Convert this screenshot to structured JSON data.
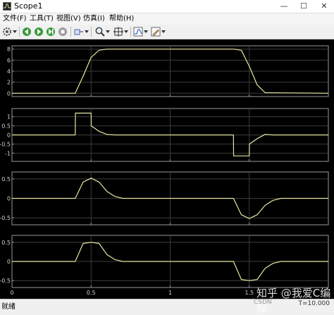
{
  "window": {
    "title": "Scope1",
    "minimize": "—",
    "maximize": "☐",
    "close": "✕"
  },
  "menu": [
    "文件(F)",
    "工具(T)",
    "视图(V)",
    "仿真(I)",
    "帮助(H)"
  ],
  "toolbar": {
    "icons": [
      "gear-icon",
      "back-icon",
      "run-icon",
      "step-forward-icon",
      "stop-icon",
      "zoom-icon",
      "autoscale-icon",
      "cursor-measure-icon",
      "edit-style-icon"
    ]
  },
  "status": {
    "left": "就绪",
    "right": "T=10.000"
  },
  "watermark": {
    "main": "知乎 @我爱C编程",
    "sub": "CSDN"
  },
  "colors": {
    "trace": "#e8e6a0",
    "grid": "#3c3c3c",
    "axes": "#9a9a9a",
    "plot_bg": "#000000"
  },
  "chart_data": [
    {
      "type": "line",
      "x": [
        0,
        0.4,
        0.45,
        0.5,
        0.55,
        0.6,
        1.4,
        1.45,
        1.5,
        1.55,
        1.6,
        2.0
      ],
      "series": [
        {
          "values": [
            0,
            0,
            3.1,
            6.5,
            7.8,
            8,
            8,
            7.8,
            4.9,
            1.5,
            0.1,
            0
          ]
        }
      ],
      "yticks": [
        "8",
        "6",
        "4",
        "2",
        "0"
      ],
      "ylim": [
        -0.6,
        8.6
      ],
      "grid": true
    },
    {
      "type": "line",
      "x": [
        0,
        0.4,
        0.401,
        0.5,
        0.501,
        0.55,
        0.6,
        0.65,
        1.4,
        1.401,
        1.5,
        1.501,
        1.55,
        1.6,
        1.65,
        2.0
      ],
      "series": [
        {
          "values": [
            0,
            0,
            1.2,
            1.2,
            0.5,
            0.2,
            0.03,
            0,
            0,
            -1.15,
            -1.15,
            -0.5,
            -0.2,
            0.03,
            0,
            0
          ]
        }
      ],
      "yticks": [
        "1",
        "0.5",
        "0",
        "-0.5",
        "-1"
      ],
      "ylim": [
        -1.45,
        1.45
      ],
      "grid": true
    },
    {
      "type": "line",
      "x": [
        0,
        0.4,
        0.45,
        0.5,
        0.55,
        0.6,
        0.65,
        0.7,
        1.4,
        1.45,
        1.5,
        1.55,
        1.6,
        1.65,
        1.7,
        2.0
      ],
      "series": [
        {
          "values": [
            0,
            0,
            0.42,
            0.52,
            0.42,
            0.18,
            0.05,
            0,
            0,
            -0.42,
            -0.52,
            -0.42,
            -0.18,
            -0.05,
            0,
            0
          ]
        }
      ],
      "yticks": [
        "0.5",
        "0",
        "-0.5"
      ],
      "ylim": [
        -0.68,
        0.68
      ],
      "grid": true
    },
    {
      "type": "line",
      "x": [
        0,
        0.4,
        0.45,
        0.5,
        0.55,
        0.6,
        0.65,
        0.7,
        1.4,
        1.45,
        1.5,
        1.55,
        1.6,
        1.65,
        1.7,
        2.0
      ],
      "series": [
        {
          "values": [
            0,
            0,
            0.47,
            0.5,
            0.47,
            0.18,
            0.05,
            0,
            0,
            -0.47,
            -0.5,
            -0.47,
            -0.18,
            -0.05,
            0,
            0
          ]
        }
      ],
      "yticks": [
        "0.5",
        "0",
        "-0.5"
      ],
      "ylim": [
        -0.68,
        0.68
      ],
      "xticks": [
        "0",
        "0.5",
        "1",
        "1.5"
      ],
      "xlim": [
        0,
        2
      ],
      "grid": true
    }
  ]
}
